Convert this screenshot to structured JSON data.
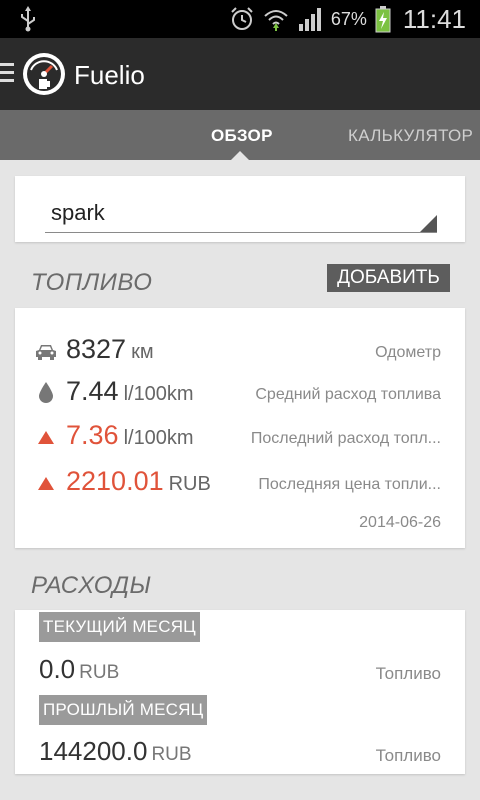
{
  "status_bar": {
    "battery_percent": "67%",
    "time": "11:41",
    "icons": [
      "usb-icon",
      "alarm-icon",
      "wifi-icon",
      "signal-icon",
      "battery-charging-icon"
    ]
  },
  "app_bar": {
    "title": "Fuelio",
    "logo_icon": "fuel-gauge-icon",
    "menu_icon": "menu-icon"
  },
  "tabs": [
    {
      "label": "ОБЗОР",
      "active": true
    },
    {
      "label": "КАЛЬКУЛЯТОР",
      "active": false
    }
  ],
  "vehicle_select": {
    "value": "spark"
  },
  "fuel": {
    "section_title": "ТОПЛИВО",
    "add_button": "ДОБАВИТЬ",
    "stats": [
      {
        "icon": "car-icon",
        "value": "8327",
        "unit": "км",
        "label": "Одометр",
        "highlight": false
      },
      {
        "icon": "drop-icon",
        "value": "7.44",
        "unit": "l/100km",
        "label": "Средний расход топлива",
        "highlight": false
      },
      {
        "icon": "triangle-up-icon",
        "value": "7.36",
        "unit": "l/100km",
        "label": "Последний расход топл...",
        "highlight": true
      },
      {
        "icon": "triangle-up-icon",
        "value": "2210.01",
        "unit": "RUB",
        "label": "Последняя цена топли...",
        "highlight": true
      }
    ],
    "date": "2014-06-26"
  },
  "expenses": {
    "section_title": "РАСХОДЫ",
    "periods": [
      {
        "badge": "ТЕКУЩИЙ МЕСЯЦ",
        "value": "0.0",
        "unit": "RUB",
        "label": "Топливо"
      },
      {
        "badge": "ПРОШЛЫЙ МЕСЯЦ",
        "value": "144200.0",
        "unit": "RUB",
        "label": "Топливо"
      }
    ]
  },
  "colors": {
    "accent": "#e0533a",
    "action_bar": "#2b2b2b",
    "tab_bar": "#6a6a6a",
    "background": "#e5e5e5"
  }
}
